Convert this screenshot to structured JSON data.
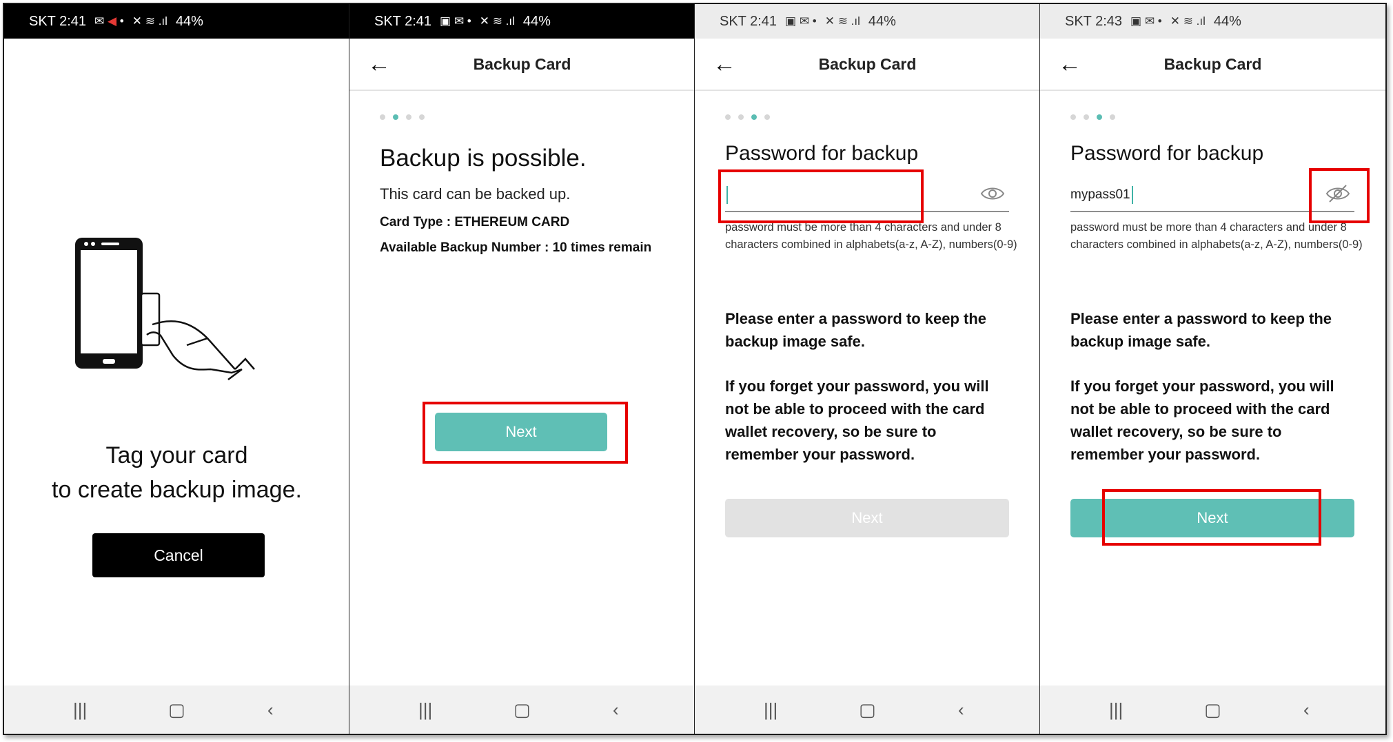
{
  "panels": [
    {
      "status": {
        "carrier_time": "SKT 2:41",
        "battery": "44%"
      },
      "tag_text_line1": "Tag your card",
      "tag_text_line2": "to create backup image.",
      "cancel_label": "Cancel"
    },
    {
      "status": {
        "carrier_time": "SKT 2:41",
        "battery": "44%"
      },
      "title": "Backup Card",
      "heading": "Backup is possible.",
      "subtext": "This card can be backed up.",
      "card_type": "Card Type : ETHEREUM CARD",
      "available_backup": "Available Backup Number : 10 times remain",
      "next_label": "Next"
    },
    {
      "status": {
        "carrier_time": "SKT 2:41",
        "battery": "44%"
      },
      "title": "Backup Card",
      "pw_title": "Password for backup",
      "pw_value": "",
      "pw_hint": "password must be more than 4 characters and under 8 characters combined in alphabets(a-z, A-Z), numbers(0-9)",
      "note1": "Please enter a password to keep the backup image safe.",
      "note2": "If you forget your password, you will not be able to proceed with the card wallet recovery, so be sure to remember your password.",
      "next_label": "Next"
    },
    {
      "status": {
        "carrier_time": "SKT 2:43",
        "battery": "44%"
      },
      "title": "Backup Card",
      "pw_title": "Password for backup",
      "pw_value": "mypass01",
      "pw_hint": "password must be more than 4 characters and under 8 characters combined in alphabets(a-z, A-Z), numbers(0-9)",
      "note1": "Please enter a password to keep the backup image safe.",
      "note2": "If you forget your password, you will not be able to proceed with the card wallet recovery, so be sure to remember your password.",
      "next_label": "Next"
    }
  ],
  "colors": {
    "accent": "#5fbfb5",
    "highlight": "#e60000",
    "disabled": "#e2e2e2"
  },
  "icons": [
    "back-arrow-icon",
    "eye-icon",
    "eye-off-icon",
    "recent-apps-icon",
    "home-icon",
    "nav-back-icon",
    "phone-card-illustration"
  ]
}
